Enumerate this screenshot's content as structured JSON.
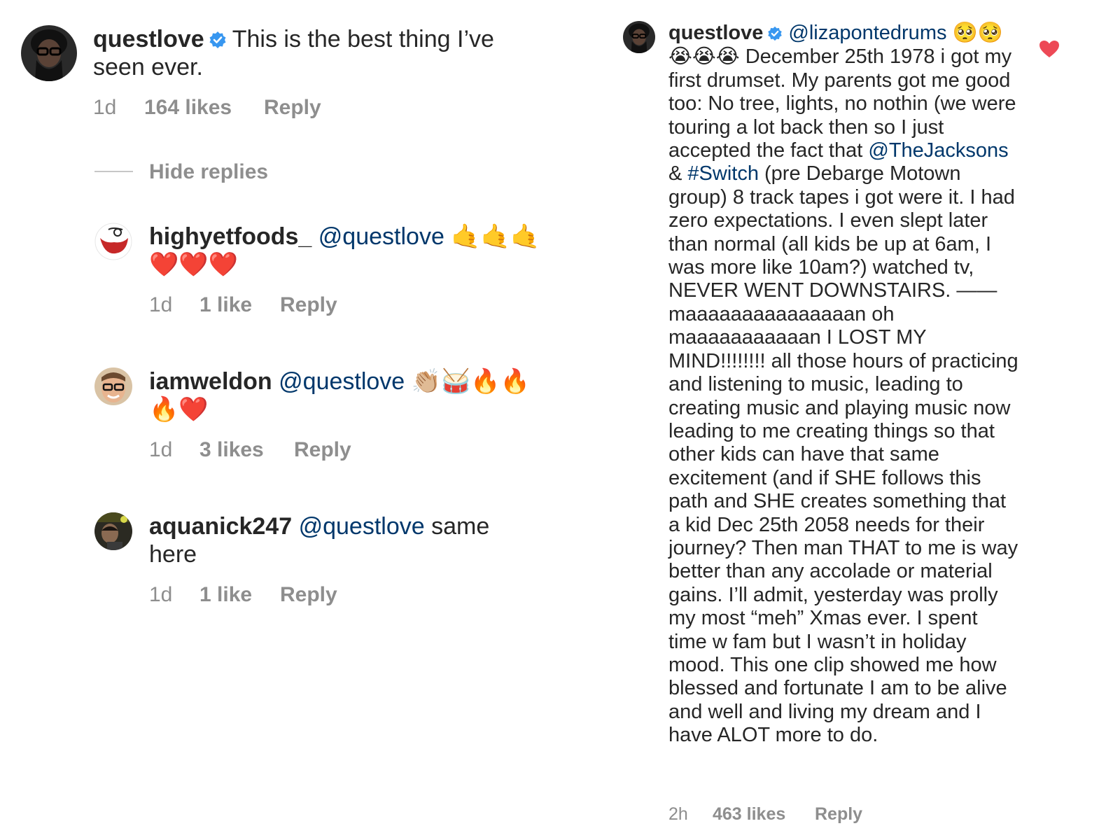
{
  "colors": {
    "text": "#262626",
    "meta": "#8e8e8e",
    "mention": "#00376b",
    "verified": "#3897f0",
    "heart": "#ed4956"
  },
  "left_thread": {
    "main": {
      "username": "questlove",
      "verified": true,
      "text": "This is the best thing I’ve seen ever.",
      "time": "1d",
      "likes": "164 likes",
      "reply": "Reply"
    },
    "hide_replies": "Hide replies",
    "replies": [
      {
        "username": "highyetfoods_",
        "mention": "@questlove",
        "emojis": "🤙🤙🤙❤️❤️❤️",
        "time": "1d",
        "likes": "1 like",
        "reply": "Reply"
      },
      {
        "username": "iamweldon",
        "mention": "@questlove",
        "emojis": "👏🏼🥁🔥🔥🔥❤️",
        "time": "1d",
        "likes": "3 likes",
        "reply": "Reply"
      },
      {
        "username": "aquanick247",
        "mention": "@questlove",
        "text": "same here",
        "time": "1d",
        "likes": "1 like",
        "reply": "Reply"
      }
    ]
  },
  "right_comment": {
    "username": "questlove",
    "verified": true,
    "mention": "@lizapontedrums",
    "emojis": "🥺🥺😭😭😭",
    "text_part1": "December 25th 1978 i got my first drumset. My parents got me good too: No tree, lights, no nothin (we were touring a lot back then so I just accepted the fact that",
    "mention2": "@TheJacksons",
    "amp": "&",
    "hashtag": "#Switch",
    "text_part2": "(pre Debarge Motown group) 8 track tapes i got were it. I had zero expectations. I even slept later than normal (all kids be up at 6am, I was more like 10am?) watched tv, NEVER WENT DOWNSTAIRS. —— maaaaaaaaaaaaaaan oh maaaaaaaaaaan I LOST MY MIND!!!!!!!! all those hours of practicing and listening to music, leading to creating music and playing music now leading to me creating things so that other kids can have that same excitement (and if SHE follows this path and SHE creates something that a kid Dec 25th 2058 needs for their journey? Then man THAT to me is way better than any accolade or material gains. I’ll admit, yesterday was prolly my most “meh” Xmas ever. I spent time w fam but I wasn’t in holiday mood. This one clip showed me how blessed and fortunate I am to be alive and well and living my dream and I have ALOT more to do.",
    "time": "2h",
    "likes": "463 likes",
    "reply": "Reply",
    "liked_icon": "heart-icon"
  }
}
